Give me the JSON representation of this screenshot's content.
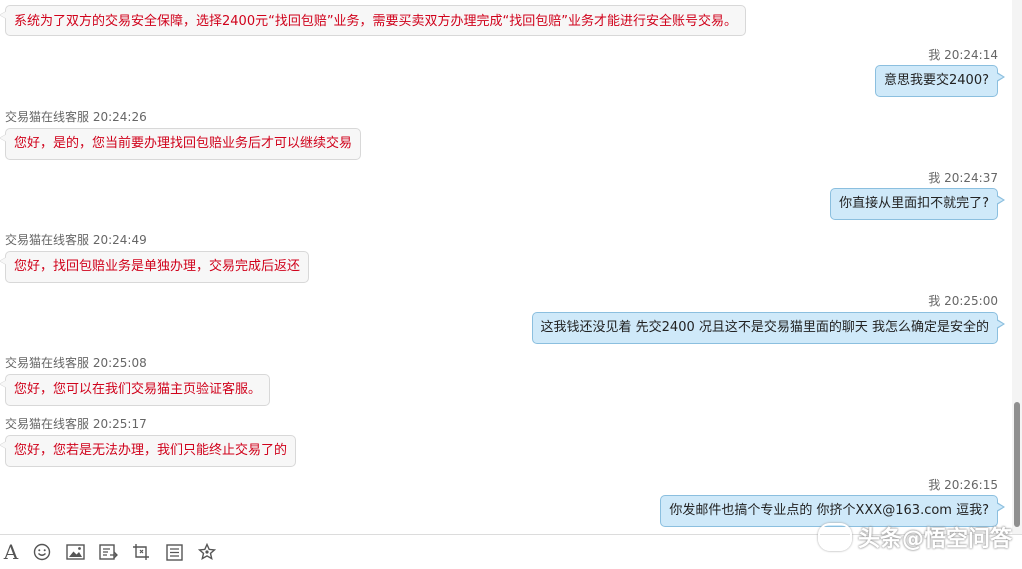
{
  "system_notice": "系统为了双方的交易安全保障，选择2400元“找回包赔”业务，需要买卖双方办理完成“找回包赔”业务才能进行安全账号交易。",
  "messages": [
    {
      "side": "right",
      "sender": "我",
      "time": "20:24:14",
      "text": "意思我要交2400?"
    },
    {
      "side": "left",
      "sender": "交易猫在线客服",
      "time": "20:24:26",
      "text": "您好，是的，您当前要办理找回包赔业务后才可以继续交易"
    },
    {
      "side": "right",
      "sender": "我",
      "time": "20:24:37",
      "text": "你直接从里面扣不就完了?"
    },
    {
      "side": "left",
      "sender": "交易猫在线客服",
      "time": "20:24:49",
      "text": "您好，找回包赔业务是单独办理，交易完成后返还"
    },
    {
      "side": "right",
      "sender": "我",
      "time": "20:25:00",
      "text": "这我钱还没见着  先交2400  况且这不是交易猫里面的聊天  我怎么确定是安全的"
    },
    {
      "side": "left",
      "sender": "交易猫在线客服",
      "time": "20:25:08",
      "text": "您好，您可以在我们交易猫主页验证客服。"
    },
    {
      "side": "left",
      "sender": "交易猫在线客服",
      "time": "20:25:17",
      "text": "您好，您若是无法办理，我们只能终止交易了的"
    },
    {
      "side": "right",
      "sender": "我",
      "time": "20:26:15",
      "text": "你发邮件也搞个专业点的  你挤个XXX@163.com  逗我?"
    }
  ],
  "toolbar": {
    "icons": [
      "font-icon",
      "emoji-icon",
      "image-icon",
      "file-send-icon",
      "screenshot-icon",
      "history-icon",
      "favorite-icon"
    ],
    "font_glyph": "A"
  },
  "watermark": "头条@悟空问答",
  "colors": {
    "agent_text": "#d0021b",
    "user_bubble": "#cfe9f9",
    "user_border": "#8bbfdf"
  }
}
